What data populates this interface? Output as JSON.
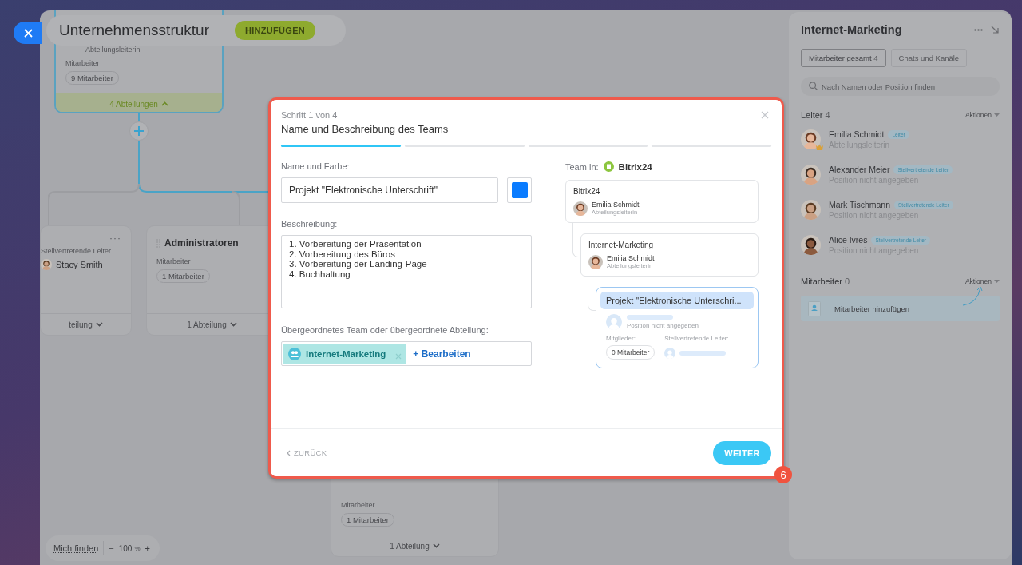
{
  "header": {
    "title": "Unternehmensstruktur",
    "add_button": "HINZUFÜGEN"
  },
  "canvas": {
    "root_node": {
      "role": "Abteilungsleiterin",
      "members_label": "Mitarbeiter",
      "members": "9 Mitarbeiter",
      "footer": "4 Abteilungen",
      "expanded": true
    },
    "nodes": [
      {
        "kind": "deputy",
        "menu": "···",
        "deputy_label": "Stellvertretende Leiter",
        "deputy": "Stacy Smith",
        "footer": "teilung",
        "expanded": false
      },
      {
        "kind": "members",
        "title": "Administratoren",
        "members_label": "Mitarbeiter",
        "members": "1 Mitarbeiter",
        "footer": "1 Abteilung",
        "expanded": false
      },
      {
        "kind": "members",
        "members_label": "Mitarbeiter",
        "members": "1 Mitarbeiter",
        "footer": "1 Abteilung",
        "expanded": false
      }
    ],
    "zoom": {
      "find_me": "Mich finden",
      "minus": "−",
      "value": "100",
      "unit": "%",
      "plus": "+"
    }
  },
  "modal": {
    "step": "Schritt 1 von 4",
    "title": "Name und Beschreibung des Teams",
    "steps": [
      {
        "active": true
      },
      {
        "active": false
      },
      {
        "active": false
      },
      {
        "active": false
      }
    ],
    "name_label": "Name und Farbe:",
    "name_value": "Projekt \"Elektronische Unterschrift\"",
    "color": "#0a7cff",
    "description_label": "Beschreibung:",
    "description": "1. Vorbereitung der Präsentation\n2. Vorbereitung des Büros\n3. Vorbereitung der Landing-Page\n4. Buchhaltung",
    "parent_label": "Übergeordnetes Team oder übergeordnete Abteilung:",
    "parent_tag": "Internet-Marketing",
    "edit_link": "+ Bearbeiten",
    "preview": {
      "label": "Team in:",
      "company": "Bitrix24",
      "tree": {
        "kind": "unit",
        "name": "Bitrix24",
        "head": {
          "name": "Emilia Schmidt",
          "role": "Abteilungsleiterin"
        },
        "children": [
          {
            "kind": "unit",
            "name": "Internet-Marketing",
            "head": {
              "name": "Emilia Schmidt",
              "role": "Abteilungsleiterin"
            },
            "children": [
              {
                "kind": "new",
                "name": "Projekt \"Elektronische Unterschri...",
                "position": "Position nicht angegeben",
                "members_label": "Mitglieder:",
                "members": "0 Mitarbeiter",
                "deputies_label": "Stellvertretende Leiter:"
              }
            ]
          }
        ]
      }
    },
    "back": "ZURÜCK",
    "next": "WEITER"
  },
  "badge": "6",
  "panel": {
    "title": "Internet-Marketing",
    "tabs": [
      {
        "label": "Mitarbeiter gesamt",
        "count": "4",
        "selected": true
      },
      {
        "label": "Chats und Kanäle",
        "selected": false
      }
    ],
    "search": {
      "placeholder": "Nach Namen oder Position finden"
    },
    "sections": [
      {
        "title": "Leiter",
        "count": "4",
        "action": "Aktionen",
        "people": [
          {
            "name": "Emilia Schmidt",
            "badge": "Leiter",
            "position": "Abteilungsleiterin",
            "crown": true
          },
          {
            "name": "Alexander Meier",
            "badge": "Stellvertretende Leiter",
            "position": "Position nicht angegeben",
            "crown": false
          },
          {
            "name": "Mark Tischmann",
            "badge": "Stellvertretende Leiter",
            "position": "Position nicht angegeben",
            "crown": false
          },
          {
            "name": "Alice Ivres",
            "badge": "Stellvertretende Leiter",
            "position": "Position nicht angegeben",
            "crown": false
          }
        ]
      },
      {
        "title": "Mitarbeiter",
        "count": "0",
        "action": "Aktionen",
        "add": "Mitarbeiter hinzufügen"
      }
    ]
  }
}
